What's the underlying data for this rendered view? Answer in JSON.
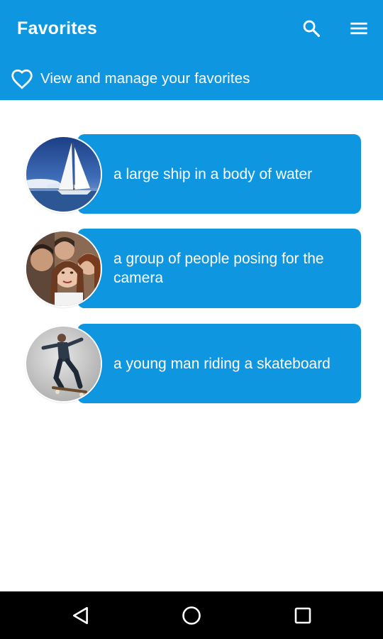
{
  "header": {
    "title": "Favorites",
    "subtitle": "View and manage your favorites",
    "search_icon": "search-icon",
    "menu_icon": "menu-icon",
    "subtitle_icon": "heart-outline-icon"
  },
  "favorites": [
    {
      "caption": "a large ship in a body of water",
      "thumbnail": "sailboat-photo"
    },
    {
      "caption": "a group of people posing for the camera",
      "thumbnail": "group-selfie-photo"
    },
    {
      "caption": "a young man riding a skateboard",
      "thumbnail": "skateboarder-photo"
    }
  ],
  "navigation": {
    "back_icon": "back-triangle-icon",
    "home_icon": "home-circle-icon",
    "recents_icon": "recents-square-icon"
  },
  "colors": {
    "primary": "#0f96e0",
    "on_primary": "#ffffff",
    "background": "#ffffff",
    "nav_bar": "#000000"
  }
}
